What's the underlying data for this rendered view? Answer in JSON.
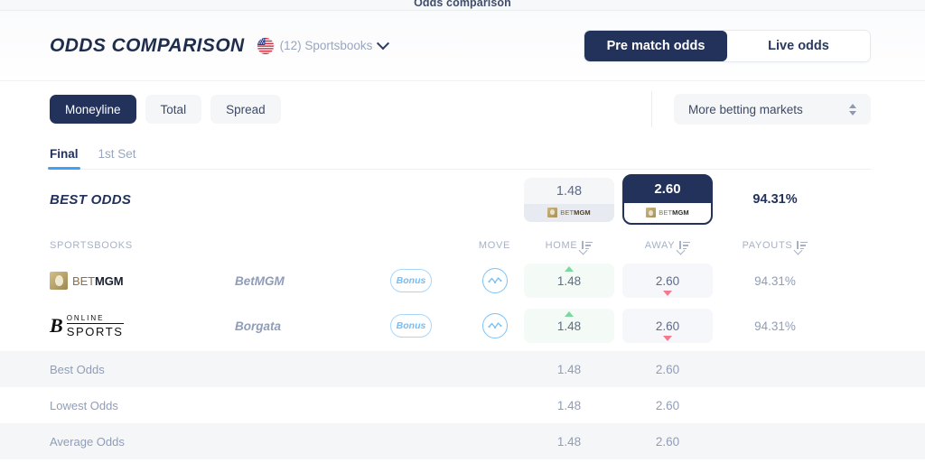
{
  "top_strip": {
    "label": "Odds comparison"
  },
  "header": {
    "brand_title": "ODDS COMPARISON",
    "flag_icon": "us-flag-icon",
    "books_label": "(12) Sportsbooks",
    "chevron_icon": "chevron-down-icon",
    "mode_tabs": [
      {
        "label": "Pre match odds",
        "active": true
      },
      {
        "label": "Live odds",
        "active": false
      }
    ]
  },
  "controls": {
    "market_pills": [
      {
        "label": "Moneyline",
        "active": true
      },
      {
        "label": "Total",
        "active": false
      },
      {
        "label": "Spread",
        "active": false
      }
    ],
    "more_markets": {
      "label": "More betting markets",
      "icon": "stepper-updown-icon"
    }
  },
  "subtabs": [
    {
      "label": "Final",
      "active": true
    },
    {
      "label": "1st Set",
      "active": false
    }
  ],
  "best_odds": {
    "label": "BEST ODDS",
    "home": {
      "value": "1.48",
      "book_logo": "betmgm-logo",
      "highlighted": false
    },
    "away": {
      "value": "2.60",
      "book_logo": "betmgm-logo",
      "highlighted": true
    },
    "payout": "94.31%"
  },
  "table": {
    "headers": {
      "sportsbooks": "SPORTSBOOKS",
      "move": "MOVE",
      "home": "HOME",
      "away": "AWAY",
      "payouts": "PAYOUTS",
      "sort_icon": "sort-descending-icon"
    },
    "rows": [
      {
        "logo": "betmgm-logo",
        "name": "BetMGM",
        "bonus_label": "Bonus",
        "move_icon": "trend-line-icon",
        "home": {
          "value": "1.48",
          "trend": "up"
        },
        "away": {
          "value": "2.60",
          "trend": "down"
        },
        "payout": "94.31%"
      },
      {
        "logo": "borgata-online-sports-logo",
        "name": "Borgata",
        "bonus_label": "Bonus",
        "move_icon": "trend-line-icon",
        "home": {
          "value": "1.48",
          "trend": "up"
        },
        "away": {
          "value": "2.60",
          "trend": "down"
        },
        "payout": "94.31%"
      }
    ],
    "summary": [
      {
        "label": "Best Odds",
        "home": "1.48",
        "away": "2.60"
      },
      {
        "label": "Lowest Odds",
        "home": "1.48",
        "away": "2.60"
      },
      {
        "label": "Average Odds",
        "home": "1.48",
        "away": "2.60"
      }
    ]
  },
  "colors": {
    "navy": "#22325b",
    "accent_blue": "#3fa2f7",
    "muted": "#8f9dba",
    "up_green": "#7ed6a0",
    "down_red": "#f07b8f",
    "gold": "#a8915a"
  }
}
